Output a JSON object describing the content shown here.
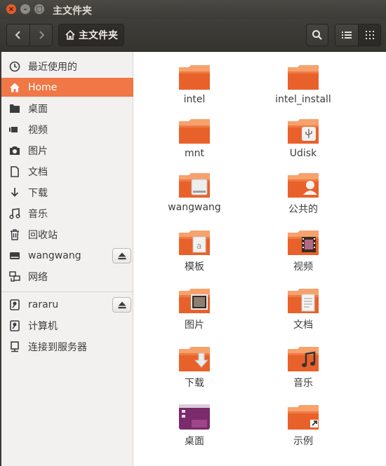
{
  "window": {
    "title": "主文件夹",
    "close_glyph": "×",
    "min_glyph": "–",
    "max_glyph": "□"
  },
  "header": {
    "back_icon": "chevron-left-icon",
    "forward_icon": "chevron-right-icon",
    "path_label": "主文件夹",
    "search_icon": "search-icon",
    "list_view_icon": "list-view-icon",
    "grid_view_icon": "grid-view-icon",
    "active_view": "grid"
  },
  "sidebar": {
    "items": [
      {
        "label": "最近使用的",
        "icon": "clock-icon"
      },
      {
        "label": "Home",
        "icon": "home-icon",
        "active": true
      },
      {
        "label": "桌面",
        "icon": "folder-icon"
      },
      {
        "label": "视频",
        "icon": "video-icon"
      },
      {
        "label": "图片",
        "icon": "camera-icon"
      },
      {
        "label": "文档",
        "icon": "document-icon"
      },
      {
        "label": "下载",
        "icon": "download-icon"
      },
      {
        "label": "音乐",
        "icon": "music-icon"
      },
      {
        "label": "回收站",
        "icon": "trash-icon"
      },
      {
        "label": "wangwang",
        "icon": "drive-icon",
        "eject": true
      },
      {
        "label": "网络",
        "icon": "network-icon"
      },
      {
        "label": "rararu",
        "icon": "removable-drive-icon",
        "eject": true
      },
      {
        "label": "计算机",
        "icon": "computer-icon"
      },
      {
        "label": "连接到服务器",
        "icon": "server-icon"
      }
    ]
  },
  "files": [
    {
      "name": "intel",
      "emblem": "none"
    },
    {
      "name": "intel_install",
      "emblem": "none"
    },
    {
      "name": "mnt",
      "emblem": "none"
    },
    {
      "name": "Udisk",
      "emblem": "usb"
    },
    {
      "name": "wangwang",
      "emblem": "drive"
    },
    {
      "name": "公共的",
      "emblem": "person"
    },
    {
      "name": "模板",
      "emblem": "template"
    },
    {
      "name": "视频",
      "emblem": "film"
    },
    {
      "name": "图片",
      "emblem": "picture"
    },
    {
      "name": "文档",
      "emblem": "document"
    },
    {
      "name": "下载",
      "emblem": "download"
    },
    {
      "name": "音乐",
      "emblem": "music"
    },
    {
      "name": "桌面",
      "emblem": "desktop"
    },
    {
      "name": "示例",
      "emblem": "link"
    }
  ],
  "colors": {
    "accent": "#f07746",
    "folder_top": "#f7a16c",
    "folder_body": "#e9612a",
    "titlebar": "#3c3b37"
  }
}
